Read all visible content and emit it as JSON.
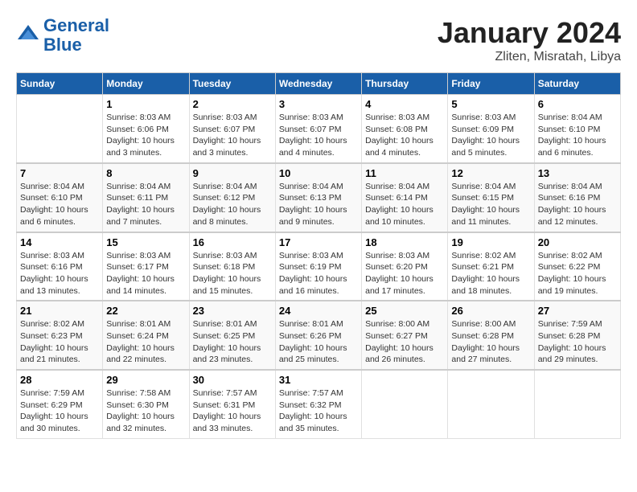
{
  "header": {
    "logo_line1": "General",
    "logo_line2": "Blue",
    "title": "January 2024",
    "subtitle": "Zliten, Misratah, Libya"
  },
  "weekdays": [
    "Sunday",
    "Monday",
    "Tuesday",
    "Wednesday",
    "Thursday",
    "Friday",
    "Saturday"
  ],
  "weeks": [
    [
      {
        "day": "",
        "info": ""
      },
      {
        "day": "1",
        "info": "Sunrise: 8:03 AM\nSunset: 6:06 PM\nDaylight: 10 hours\nand 3 minutes."
      },
      {
        "day": "2",
        "info": "Sunrise: 8:03 AM\nSunset: 6:07 PM\nDaylight: 10 hours\nand 3 minutes."
      },
      {
        "day": "3",
        "info": "Sunrise: 8:03 AM\nSunset: 6:07 PM\nDaylight: 10 hours\nand 4 minutes."
      },
      {
        "day": "4",
        "info": "Sunrise: 8:03 AM\nSunset: 6:08 PM\nDaylight: 10 hours\nand 4 minutes."
      },
      {
        "day": "5",
        "info": "Sunrise: 8:03 AM\nSunset: 6:09 PM\nDaylight: 10 hours\nand 5 minutes."
      },
      {
        "day": "6",
        "info": "Sunrise: 8:04 AM\nSunset: 6:10 PM\nDaylight: 10 hours\nand 6 minutes."
      }
    ],
    [
      {
        "day": "7",
        "info": "Sunrise: 8:04 AM\nSunset: 6:10 PM\nDaylight: 10 hours\nand 6 minutes."
      },
      {
        "day": "8",
        "info": "Sunrise: 8:04 AM\nSunset: 6:11 PM\nDaylight: 10 hours\nand 7 minutes."
      },
      {
        "day": "9",
        "info": "Sunrise: 8:04 AM\nSunset: 6:12 PM\nDaylight: 10 hours\nand 8 minutes."
      },
      {
        "day": "10",
        "info": "Sunrise: 8:04 AM\nSunset: 6:13 PM\nDaylight: 10 hours\nand 9 minutes."
      },
      {
        "day": "11",
        "info": "Sunrise: 8:04 AM\nSunset: 6:14 PM\nDaylight: 10 hours\nand 10 minutes."
      },
      {
        "day": "12",
        "info": "Sunrise: 8:04 AM\nSunset: 6:15 PM\nDaylight: 10 hours\nand 11 minutes."
      },
      {
        "day": "13",
        "info": "Sunrise: 8:04 AM\nSunset: 6:16 PM\nDaylight: 10 hours\nand 12 minutes."
      }
    ],
    [
      {
        "day": "14",
        "info": "Sunrise: 8:03 AM\nSunset: 6:16 PM\nDaylight: 10 hours\nand 13 minutes."
      },
      {
        "day": "15",
        "info": "Sunrise: 8:03 AM\nSunset: 6:17 PM\nDaylight: 10 hours\nand 14 minutes."
      },
      {
        "day": "16",
        "info": "Sunrise: 8:03 AM\nSunset: 6:18 PM\nDaylight: 10 hours\nand 15 minutes."
      },
      {
        "day": "17",
        "info": "Sunrise: 8:03 AM\nSunset: 6:19 PM\nDaylight: 10 hours\nand 16 minutes."
      },
      {
        "day": "18",
        "info": "Sunrise: 8:03 AM\nSunset: 6:20 PM\nDaylight: 10 hours\nand 17 minutes."
      },
      {
        "day": "19",
        "info": "Sunrise: 8:02 AM\nSunset: 6:21 PM\nDaylight: 10 hours\nand 18 minutes."
      },
      {
        "day": "20",
        "info": "Sunrise: 8:02 AM\nSunset: 6:22 PM\nDaylight: 10 hours\nand 19 minutes."
      }
    ],
    [
      {
        "day": "21",
        "info": "Sunrise: 8:02 AM\nSunset: 6:23 PM\nDaylight: 10 hours\nand 21 minutes."
      },
      {
        "day": "22",
        "info": "Sunrise: 8:01 AM\nSunset: 6:24 PM\nDaylight: 10 hours\nand 22 minutes."
      },
      {
        "day": "23",
        "info": "Sunrise: 8:01 AM\nSunset: 6:25 PM\nDaylight: 10 hours\nand 23 minutes."
      },
      {
        "day": "24",
        "info": "Sunrise: 8:01 AM\nSunset: 6:26 PM\nDaylight: 10 hours\nand 25 minutes."
      },
      {
        "day": "25",
        "info": "Sunrise: 8:00 AM\nSunset: 6:27 PM\nDaylight: 10 hours\nand 26 minutes."
      },
      {
        "day": "26",
        "info": "Sunrise: 8:00 AM\nSunset: 6:28 PM\nDaylight: 10 hours\nand 27 minutes."
      },
      {
        "day": "27",
        "info": "Sunrise: 7:59 AM\nSunset: 6:28 PM\nDaylight: 10 hours\nand 29 minutes."
      }
    ],
    [
      {
        "day": "28",
        "info": "Sunrise: 7:59 AM\nSunset: 6:29 PM\nDaylight: 10 hours\nand 30 minutes."
      },
      {
        "day": "29",
        "info": "Sunrise: 7:58 AM\nSunset: 6:30 PM\nDaylight: 10 hours\nand 32 minutes."
      },
      {
        "day": "30",
        "info": "Sunrise: 7:57 AM\nSunset: 6:31 PM\nDaylight: 10 hours\nand 33 minutes."
      },
      {
        "day": "31",
        "info": "Sunrise: 7:57 AM\nSunset: 6:32 PM\nDaylight: 10 hours\nand 35 minutes."
      },
      {
        "day": "",
        "info": ""
      },
      {
        "day": "",
        "info": ""
      },
      {
        "day": "",
        "info": ""
      }
    ]
  ]
}
